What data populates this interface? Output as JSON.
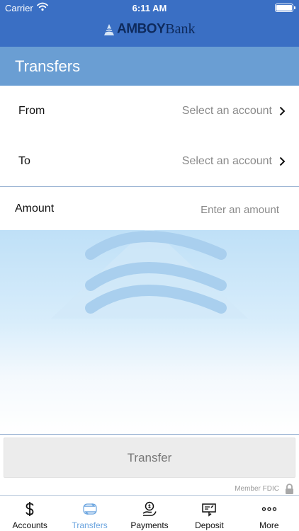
{
  "status_bar": {
    "carrier": "Carrier",
    "time": "6:11 AM"
  },
  "brand": {
    "name_bold": "AMBOY",
    "name_light": "Bank",
    "color": "#0e2a5c"
  },
  "header": {
    "title": "Transfers",
    "bg_color": "#3a6fc4",
    "title_bg_color": "#6a9ed3"
  },
  "form": {
    "from": {
      "label": "From",
      "value": "Select an account"
    },
    "to": {
      "label": "To",
      "value": "Select an account"
    },
    "amount": {
      "label": "Amount",
      "placeholder": "Enter an amount"
    }
  },
  "actions": {
    "transfer_label": "Transfer"
  },
  "footer": {
    "fdic": "Member FDIC"
  },
  "tabs": [
    {
      "label": "Accounts",
      "icon": "dollar-icon",
      "active": false
    },
    {
      "label": "Transfers",
      "icon": "transfer-arrows-icon",
      "active": true
    },
    {
      "label": "Payments",
      "icon": "hand-coin-icon",
      "active": false
    },
    {
      "label": "Deposit",
      "icon": "check-deposit-icon",
      "active": false
    },
    {
      "label": "More",
      "icon": "more-dots-icon",
      "active": false
    }
  ],
  "colors": {
    "accent": "#6aa4df",
    "divider": "#9db6d4"
  }
}
